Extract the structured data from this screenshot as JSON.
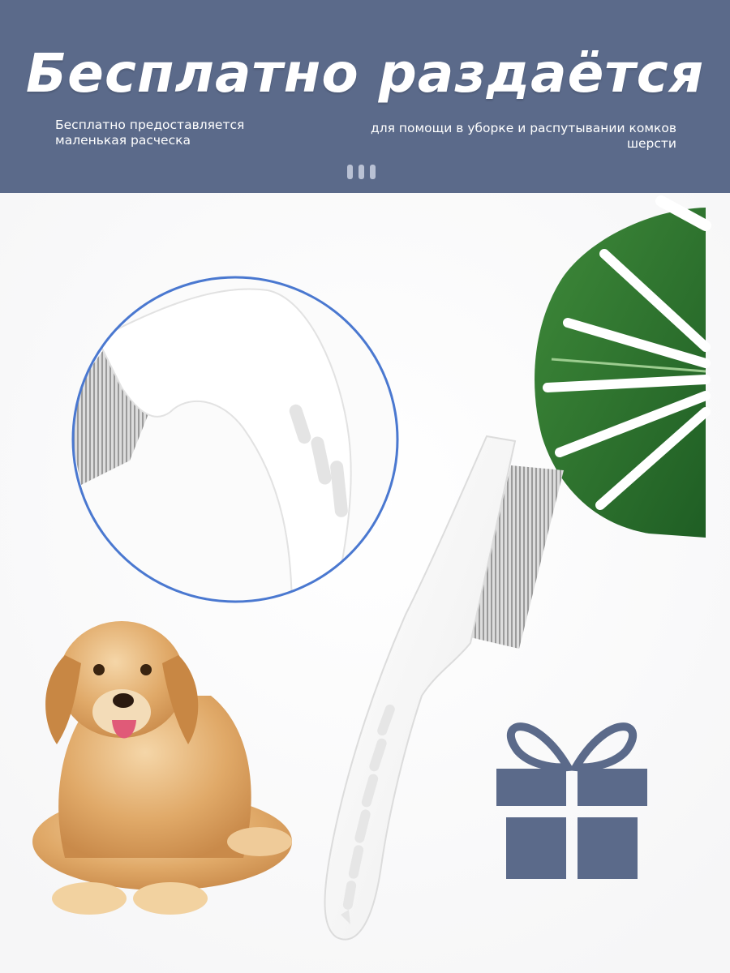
{
  "header": {
    "title": "Бесплатно раздаётся",
    "subtitle_left": "Бесплатно предоставляется маленькая расческа",
    "subtitle_right": "для помощи в уборке и распутывании комков шерсти",
    "pager_icon": "three-bars-indicator"
  },
  "colors": {
    "header_bg": "#5b6a8a",
    "gift": "#5b6a8a",
    "zoom_ring": "#4a78d0"
  },
  "icons": {
    "gift": "gift-icon",
    "leaf": "monstera-leaf",
    "dog": "golden-retriever",
    "comb": "flea-comb"
  }
}
